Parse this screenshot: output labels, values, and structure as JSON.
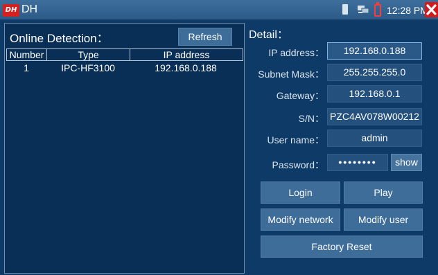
{
  "titlebar": {
    "logo_text": "DH",
    "title": "DH",
    "clock": "12:28 PM"
  },
  "colors": {
    "background": "#0d3a66",
    "titlebar": "#2c5a87",
    "button": "#3e6d9a",
    "field": "#23507c",
    "logo_red": "#d61f1f",
    "battery_red": "#ff3b3b"
  },
  "icons": {
    "sd_card": "sd-card-icon",
    "network": "network-icon",
    "battery": "battery-low-icon",
    "close": "close-icon"
  },
  "online_detection": {
    "title": "Online Detection：",
    "refresh_label": "Refresh",
    "columns": [
      "Number",
      "Type",
      "IP address"
    ],
    "rows": [
      {
        "number": "1",
        "type": "IPC-HF3100",
        "ip": "192.168.0.188"
      }
    ]
  },
  "detail": {
    "title": "Detail：",
    "fields": {
      "ip": {
        "label": "IP address：",
        "value": "192.168.0.188"
      },
      "mask": {
        "label": "Subnet Mask：",
        "value": "255.255.255.0"
      },
      "gateway": {
        "label": "Gateway：",
        "value": "192.168.0.1"
      },
      "sn": {
        "label": "S/N：",
        "value": "PZC4AV078W00212"
      },
      "user": {
        "label": "User name：",
        "value": "admin"
      },
      "password": {
        "label": "Password：",
        "value": "••••••••"
      }
    },
    "show_label": "show",
    "buttons": {
      "login": "Login",
      "play": "Play",
      "modify_network": "Modify network",
      "modify_user": "Modify user",
      "factory_reset": "Factory Reset"
    }
  }
}
